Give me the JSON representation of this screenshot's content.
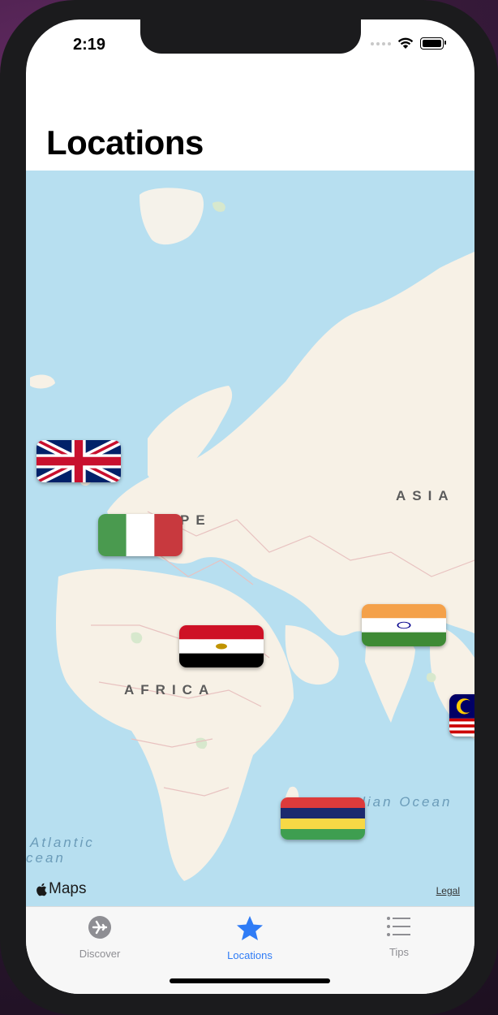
{
  "status_bar": {
    "time": "2:19"
  },
  "page": {
    "title": "Locations"
  },
  "map": {
    "labels": {
      "asia": "ASIA",
      "europe": "PE",
      "africa": "AFRICA"
    },
    "oceans": {
      "indian": "ndian Ocean",
      "atlantic_line1": "Atlantic",
      "atlantic_line2": "cean"
    },
    "attribution": "Maps",
    "legal": "Legal",
    "flags": [
      "United Kingdom",
      "Italy",
      "Egypt",
      "India",
      "Malaysia",
      "Mauritius"
    ]
  },
  "tabbar": {
    "tabs": [
      {
        "label": "Discover",
        "icon": "airplane-icon",
        "active": false
      },
      {
        "label": "Locations",
        "icon": "star-icon",
        "active": true
      },
      {
        "label": "Tips",
        "icon": "list-icon",
        "active": false
      }
    ],
    "colors": {
      "active": "#2f7cf6",
      "inactive": "#8e8e93"
    }
  }
}
